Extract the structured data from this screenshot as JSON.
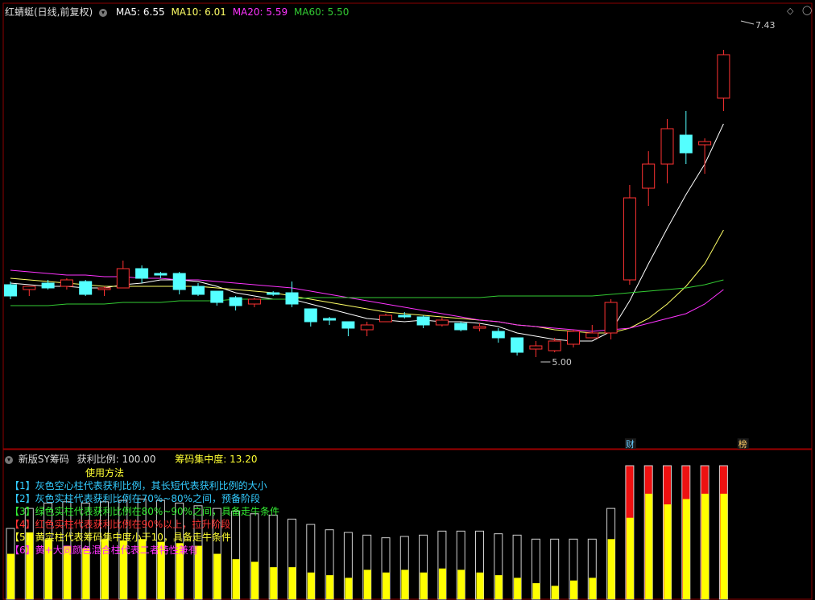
{
  "main_panel": {
    "title": "红蜻蜓(日线,前复权)",
    "ma_legend": [
      {
        "label": "MA5: 6.55",
        "color": "#ffffff"
      },
      {
        "label": "MA10: 6.01",
        "color": "#ffff66"
      },
      {
        "label": "MA20: 5.59",
        "color": "#ff33ff"
      },
      {
        "label": "MA60: 5.50",
        "color": "#33cc33"
      }
    ],
    "high_marker": "7.43",
    "low_marker": "5.00",
    "badge_cai": "财",
    "badge_bang": "榜"
  },
  "sub_panel": {
    "title": "新版SY筹码",
    "profit_label": "获利比例: 100.00",
    "concentration_label": "筹码集中度: 13.20",
    "guide_title": "使用方法",
    "guide_lines": [
      {
        "text": "【1】灰色空心柱代表获利比例，其长短代表获利比例的大小",
        "color": "#33ccff"
      },
      {
        "text": "【2】灰色实柱代表获利比例在70%~80%之间，预备阶段",
        "color": "#33ccff"
      },
      {
        "text": "【3】绿色实柱代表获利比例在80%~90%之间，具备走牛条件",
        "color": "#33ee33"
      },
      {
        "text": "【4】红色实柱代表获利比例在90%以上，拉升阶段",
        "color": "#ff3333"
      },
      {
        "text": "【5】黄实柱代表筹码集中度小于10，具备走牛条件",
        "color": "#ffff33"
      },
      {
        "text": "【6】黄+大同颜色混合柱代表二者特性兼有",
        "color": "#ff33ff"
      }
    ]
  },
  "chart_data": [
    {
      "type": "candlestick",
      "title": "红蜻蜓(日线,前复权)",
      "ylim": [
        5.0,
        7.6
      ],
      "candles": [
        {
          "o": 5.97,
          "h": 5.99,
          "l": 5.88,
          "c": 5.9,
          "up": false
        },
        {
          "o": 5.94,
          "h": 5.96,
          "l": 5.9,
          "c": 5.96,
          "up": true
        },
        {
          "o": 5.98,
          "h": 6.0,
          "l": 5.94,
          "c": 5.95,
          "up": false
        },
        {
          "o": 5.96,
          "h": 6.01,
          "l": 5.94,
          "c": 6.0,
          "up": true
        },
        {
          "o": 5.99,
          "h": 6.0,
          "l": 5.9,
          "c": 5.91,
          "up": false
        },
        {
          "o": 5.94,
          "h": 5.96,
          "l": 5.9,
          "c": 5.95,
          "up": true
        },
        {
          "o": 5.95,
          "h": 6.12,
          "l": 5.95,
          "c": 6.07,
          "up": true
        },
        {
          "o": 6.07,
          "h": 6.09,
          "l": 5.98,
          "c": 6.01,
          "up": false
        },
        {
          "o": 6.04,
          "h": 6.05,
          "l": 6.01,
          "c": 6.03,
          "up": false
        },
        {
          "o": 6.04,
          "h": 6.05,
          "l": 5.91,
          "c": 5.94,
          "up": false
        },
        {
          "o": 5.96,
          "h": 5.98,
          "l": 5.9,
          "c": 5.91,
          "up": false
        },
        {
          "o": 5.93,
          "h": 5.93,
          "l": 5.84,
          "c": 5.86,
          "up": false
        },
        {
          "o": 5.89,
          "h": 5.9,
          "l": 5.81,
          "c": 5.84,
          "up": false
        },
        {
          "o": 5.85,
          "h": 5.89,
          "l": 5.83,
          "c": 5.88,
          "up": true
        },
        {
          "o": 5.92,
          "h": 5.93,
          "l": 5.9,
          "c": 5.91,
          "up": false
        },
        {
          "o": 5.92,
          "h": 5.99,
          "l": 5.83,
          "c": 5.85,
          "up": false
        },
        {
          "o": 5.82,
          "h": 5.82,
          "l": 5.71,
          "c": 5.74,
          "up": false
        },
        {
          "o": 5.76,
          "h": 5.77,
          "l": 5.72,
          "c": 5.75,
          "up": false
        },
        {
          "o": 5.74,
          "h": 5.74,
          "l": 5.65,
          "c": 5.7,
          "up": false
        },
        {
          "o": 5.69,
          "h": 5.74,
          "l": 5.65,
          "c": 5.72,
          "up": true
        },
        {
          "o": 5.74,
          "h": 5.79,
          "l": 5.74,
          "c": 5.78,
          "up": true
        },
        {
          "o": 5.77,
          "h": 5.8,
          "l": 5.76,
          "c": 5.78,
          "up": false
        },
        {
          "o": 5.77,
          "h": 5.78,
          "l": 5.7,
          "c": 5.72,
          "up": false
        },
        {
          "o": 5.72,
          "h": 5.77,
          "l": 5.71,
          "c": 5.75,
          "up": true
        },
        {
          "o": 5.73,
          "h": 5.74,
          "l": 5.68,
          "c": 5.69,
          "up": false
        },
        {
          "o": 5.7,
          "h": 5.73,
          "l": 5.68,
          "c": 5.71,
          "up": true
        },
        {
          "o": 5.68,
          "h": 5.7,
          "l": 5.61,
          "c": 5.64,
          "up": false
        },
        {
          "o": 5.64,
          "h": 5.64,
          "l": 5.53,
          "c": 5.55,
          "up": false
        },
        {
          "o": 5.57,
          "h": 5.62,
          "l": 5.52,
          "c": 5.59,
          "up": true
        },
        {
          "o": 5.56,
          "h": 5.64,
          "l": 5.55,
          "c": 5.62,
          "up": true
        },
        {
          "o": 5.6,
          "h": 5.69,
          "l": 5.58,
          "c": 5.68,
          "up": true
        },
        {
          "o": 5.64,
          "h": 5.72,
          "l": 5.64,
          "c": 5.67,
          "up": true
        },
        {
          "o": 5.67,
          "h": 5.88,
          "l": 5.63,
          "c": 5.86,
          "up": true
        },
        {
          "o": 6.0,
          "h": 6.59,
          "l": 5.97,
          "c": 6.51,
          "up": true
        },
        {
          "o": 6.57,
          "h": 6.8,
          "l": 6.46,
          "c": 6.72,
          "up": true
        },
        {
          "o": 6.72,
          "h": 7.0,
          "l": 6.6,
          "c": 6.94,
          "up": true
        },
        {
          "o": 6.79,
          "h": 7.05,
          "l": 6.72,
          "c": 6.9,
          "up": false
        },
        {
          "o": 6.84,
          "h": 6.88,
          "l": 6.66,
          "c": 6.86,
          "up": true
        },
        {
          "o": 7.13,
          "h": 7.43,
          "l": 7.05,
          "c": 7.4,
          "up": true
        }
      ],
      "series": [
        {
          "name": "MA5",
          "color": "#ffffff",
          "values": [
            5.98,
            5.97,
            5.96,
            5.96,
            5.95,
            5.95,
            5.97,
            5.98,
            6.0,
            6.0,
            5.99,
            5.96,
            5.92,
            5.9,
            5.88,
            5.88,
            5.85,
            5.82,
            5.79,
            5.76,
            5.75,
            5.74,
            5.75,
            5.74,
            5.74,
            5.73,
            5.71,
            5.67,
            5.65,
            5.63,
            5.62,
            5.62,
            5.68,
            5.87,
            6.1,
            6.32,
            6.53,
            6.72,
            6.97
          ]
        },
        {
          "name": "MA10",
          "color": "#ffff66",
          "values": [
            6.01,
            6.0,
            5.99,
            5.98,
            5.97,
            5.96,
            5.96,
            5.96,
            5.96,
            5.96,
            5.96,
            5.95,
            5.94,
            5.93,
            5.92,
            5.9,
            5.88,
            5.86,
            5.84,
            5.82,
            5.8,
            5.79,
            5.78,
            5.77,
            5.76,
            5.75,
            5.74,
            5.72,
            5.71,
            5.69,
            5.68,
            5.67,
            5.67,
            5.7,
            5.76,
            5.85,
            5.96,
            6.1,
            6.31
          ]
        },
        {
          "name": "MA20",
          "color": "#ff33ff",
          "values": [
            6.06,
            6.05,
            6.04,
            6.03,
            6.03,
            6.02,
            6.02,
            6.01,
            6.01,
            6.0,
            6.0,
            5.99,
            5.98,
            5.97,
            5.96,
            5.95,
            5.93,
            5.91,
            5.89,
            5.87,
            5.85,
            5.83,
            5.81,
            5.79,
            5.77,
            5.75,
            5.74,
            5.72,
            5.71,
            5.7,
            5.69,
            5.68,
            5.69,
            5.7,
            5.73,
            5.76,
            5.79,
            5.85,
            5.94
          ]
        },
        {
          "name": "MA60",
          "color": "#33cc33",
          "values": [
            5.84,
            5.84,
            5.84,
            5.85,
            5.85,
            5.85,
            5.86,
            5.86,
            5.86,
            5.87,
            5.87,
            5.87,
            5.88,
            5.88,
            5.88,
            5.88,
            5.89,
            5.89,
            5.89,
            5.89,
            5.89,
            5.89,
            5.89,
            5.89,
            5.89,
            5.89,
            5.9,
            5.9,
            5.9,
            5.9,
            5.9,
            5.9,
            5.91,
            5.92,
            5.93,
            5.94,
            5.95,
            5.97,
            6.0
          ]
        }
      ]
    },
    {
      "type": "bar",
      "title": "新版SY筹码",
      "ylim": [
        0,
        100
      ],
      "profit_ratio": [
        53,
        68,
        72,
        73,
        72,
        73,
        74,
        75,
        74,
        72,
        70,
        68,
        66,
        64,
        63,
        60,
        56,
        52,
        50,
        48,
        46,
        47,
        48,
        51,
        51,
        51,
        49,
        48,
        45,
        45,
        45,
        45,
        68,
        100,
        100,
        100,
        100,
        100,
        100
      ],
      "concentration": [
        34,
        50,
        45,
        40,
        38,
        45,
        44,
        45,
        43,
        42,
        40,
        34,
        30,
        28,
        24,
        24,
        20,
        18,
        16,
        22,
        20,
        22,
        20,
        23,
        22,
        20,
        18,
        16,
        12,
        10,
        14,
        16,
        45,
        61,
        79,
        71,
        75,
        79,
        79
      ]
    }
  ]
}
